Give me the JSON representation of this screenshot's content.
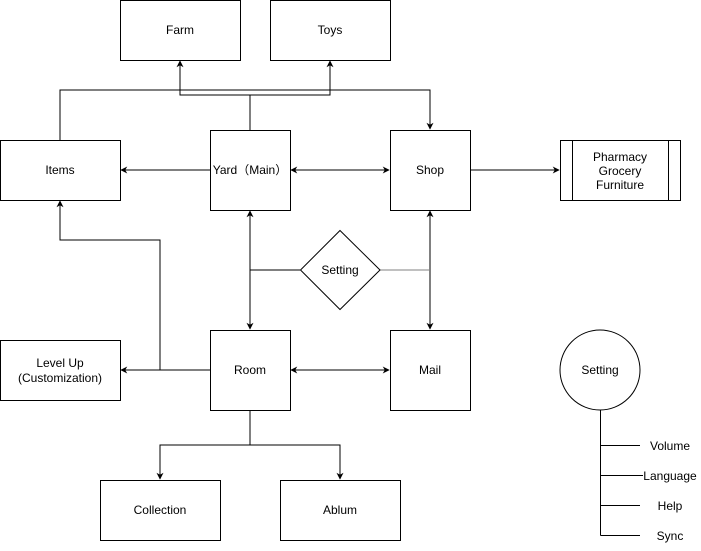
{
  "diagram": {
    "nodes": {
      "farm": "Farm",
      "toys": "Toys",
      "items": "Items",
      "yard": "Yard（Main）",
      "shop": "Shop",
      "shop_categories": [
        "Pharmacy",
        "Grocery",
        "Furniture"
      ],
      "setting_decision": "Setting",
      "level_up": [
        "Level Up",
        "(Customization)"
      ],
      "room": "Room",
      "mail": "Mail",
      "collection": "Collection",
      "album": "Ablum",
      "setting_circle": "Setting"
    },
    "setting_options": [
      "Volume",
      "Language",
      "Help",
      "Sync"
    ],
    "edges": [
      {
        "from": "Yard (Main)",
        "to": "Farm",
        "type": "directed"
      },
      {
        "from": "Yard (Main)",
        "to": "Toys",
        "type": "directed"
      },
      {
        "from": "Items",
        "to": "Shop",
        "type": "directed"
      },
      {
        "from": "Yard (Main)",
        "to": "Items",
        "type": "directed"
      },
      {
        "from": "Yard (Main)",
        "to": "Shop",
        "type": "bidirectional"
      },
      {
        "from": "Shop",
        "to": "Pharmacy/Grocery/Furniture",
        "type": "directed"
      },
      {
        "from": "Yard (Main)",
        "to": "Room",
        "type": "bidirectional"
      },
      {
        "from": "Shop",
        "to": "Mail",
        "type": "bidirectional"
      },
      {
        "from": "Setting",
        "to": "Yard-Room link",
        "type": "line"
      },
      {
        "from": "Setting",
        "to": "Shop-Mail link",
        "type": "line"
      },
      {
        "from": "Room",
        "to": "Level Up (Customization)",
        "type": "directed"
      },
      {
        "from": "Room",
        "to": "Items",
        "type": "directed"
      },
      {
        "from": "Room",
        "to": "Mail",
        "type": "bidirectional"
      },
      {
        "from": "Room",
        "to": "Collection",
        "type": "directed"
      },
      {
        "from": "Room",
        "to": "Ablum",
        "type": "directed"
      }
    ]
  }
}
